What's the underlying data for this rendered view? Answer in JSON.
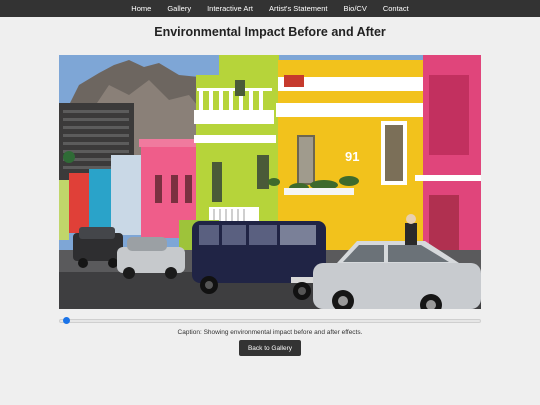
{
  "nav": {
    "items": [
      {
        "label": "Home"
      },
      {
        "label": "Gallery"
      },
      {
        "label": "Interactive Art"
      },
      {
        "label": "Artist's Statement"
      },
      {
        "label": "Bio/CV"
      },
      {
        "label": "Contact"
      }
    ]
  },
  "page": {
    "title": "Environmental Impact Before and After"
  },
  "photo": {
    "house_number": "91"
  },
  "slider": {
    "value": 0.01,
    "accent_color": "#1a73e8"
  },
  "caption": "Caption: Showing environmental impact before and after effects.",
  "back_button_label": "Back to Gallery",
  "colors": {
    "nav_bg": "#333333",
    "page_bg": "#efefef",
    "button_bg": "#333333"
  }
}
